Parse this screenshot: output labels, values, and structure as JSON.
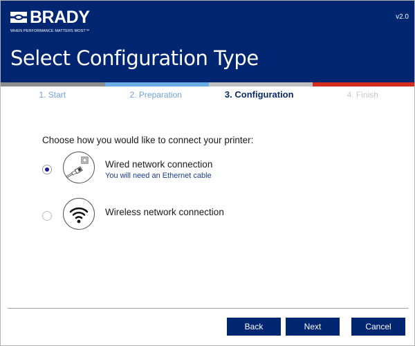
{
  "header": {
    "brand": "BRADY",
    "tagline": "WHEN PERFORMANCE MATTERS MOST™",
    "version": "v2.0",
    "title": "Select Configuration Type",
    "background_color": "#002671"
  },
  "progress": {
    "segments": [
      {
        "color": "#8c8c8c"
      },
      {
        "color": "#6aace6"
      },
      {
        "color": "#c0c0c0"
      },
      {
        "color": "#d52b1e"
      }
    ]
  },
  "steps": [
    {
      "label": "1. Start",
      "state": "done"
    },
    {
      "label": "2. Preparation",
      "state": "done"
    },
    {
      "label": "3. Configuration",
      "state": "active"
    },
    {
      "label": "4. Finish",
      "state": "future"
    }
  ],
  "content": {
    "prompt": "Choose how you would like to connect your printer:",
    "options": [
      {
        "title": "Wired network connection",
        "subtitle": "You will need an Ethernet cable",
        "icon": "ethernet-cable-icon",
        "selected": true
      },
      {
        "title": "Wireless network connection",
        "subtitle": "",
        "icon": "wifi-icon",
        "selected": false
      }
    ]
  },
  "buttons": {
    "back": "Back",
    "next": "Next",
    "cancel": "Cancel"
  }
}
